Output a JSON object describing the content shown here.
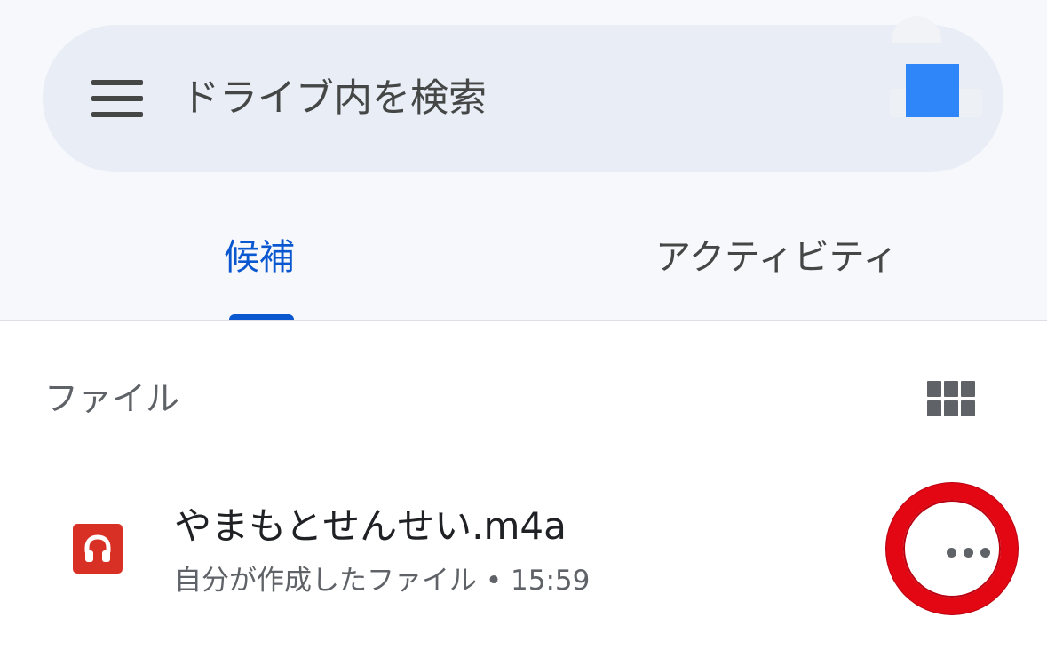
{
  "search": {
    "placeholder": "ドライブ内を検索",
    "menu_icon": "menu-icon",
    "account_icon": "account-avatar-icon"
  },
  "tabs": [
    {
      "label": "候補",
      "selected": true
    },
    {
      "label": "アクティビティ",
      "selected": false
    }
  ],
  "section": {
    "title": "ファイル",
    "view_icon": "grid-view-icon"
  },
  "files": [
    {
      "name": "やまもとせんせい.m4a",
      "meta": "自分が作成したファイル • 15:59",
      "icon": "audio-file-icon",
      "more_icon": "more-horizontal-icon"
    }
  ],
  "colors": {
    "accent": "#0b57d0",
    "audio_file": "#d93025",
    "highlight_ring": "#e30613",
    "avatar": "#2f86f9"
  }
}
